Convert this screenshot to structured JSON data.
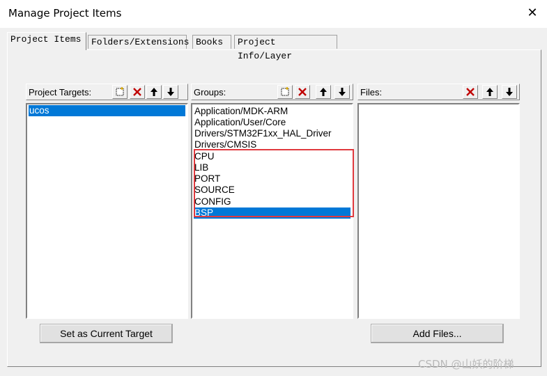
{
  "window": {
    "title": "Manage Project Items",
    "close_glyph": "✕"
  },
  "tabs": [
    {
      "label": "Project Items",
      "active": true
    },
    {
      "label": "Folders/Extensions",
      "active": false
    },
    {
      "label": "Books",
      "active": false
    },
    {
      "label": "Project Info/Layer",
      "active": false
    }
  ],
  "targets": {
    "label": "Project Targets:",
    "items": [
      "ucos"
    ],
    "selected": 0,
    "button_label": "Set as Current Target"
  },
  "groups": {
    "label": "Groups:",
    "items": [
      "Application/MDK-ARM",
      "Application/User/Core",
      "Drivers/STM32F1xx_HAL_Driver",
      "Drivers/CMSIS",
      "CPU",
      "LIB",
      "PORT",
      "SOURCE",
      "CONFIG",
      "BSP"
    ],
    "selected": 9
  },
  "files": {
    "label": "Files:",
    "items": [],
    "button_label": "Add Files..."
  },
  "toolbar_icons": [
    "new-icon",
    "delete-icon",
    "move-up-icon",
    "move-down-icon"
  ],
  "colors": {
    "selection": "#0078d7",
    "highlight_box": "#e0393e",
    "delete": "#c00000"
  },
  "watermark": "CSDN @山妖的阶梯"
}
